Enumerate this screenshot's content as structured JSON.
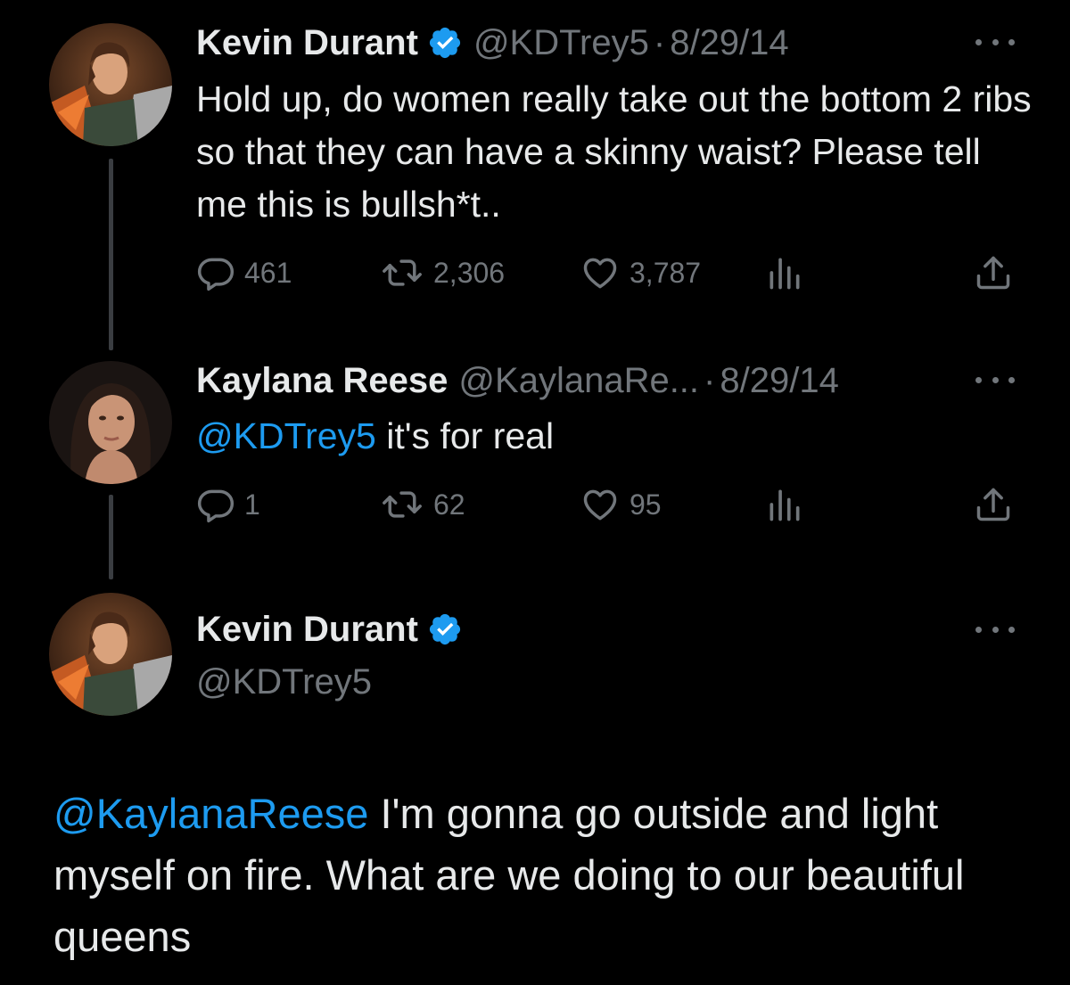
{
  "tweets": [
    {
      "author_name": "Kevin Durant",
      "handle": "@KDTrey5",
      "separator": "·",
      "date": "8/29/14",
      "verified": true,
      "avatar_icon": "animated-character-avatar",
      "text": "Hold up, do women really take out the bottom 2 ribs so that they can have a skinny waist? Please tell me this is bullsh*t..",
      "replies": "461",
      "retweets": "2,306",
      "likes": "3,787"
    },
    {
      "author_name": "Kaylana Reese",
      "handle": "@KaylanaRe...",
      "separator": "·",
      "date": "8/29/14",
      "verified": false,
      "avatar_icon": "woman-portrait-avatar",
      "mention": "@KDTrey5",
      "text": " it's for real",
      "replies": "1",
      "retweets": "62",
      "likes": "95"
    },
    {
      "author_name": "Kevin Durant",
      "handle": "@KDTrey5",
      "verified": true,
      "avatar_icon": "animated-character-avatar",
      "mention": "@KaylanaReese",
      "text": " I'm gonna go outside and light myself on fire. What are we doing to our beautiful queens"
    }
  ],
  "colors": {
    "background": "#000000",
    "text": "#e7e9ea",
    "secondary": "#71767b",
    "accent": "#1d9bf0",
    "thread_line": "#3a3d41"
  },
  "icons": [
    "reply-icon",
    "retweet-icon",
    "like-icon",
    "views-icon",
    "share-icon",
    "verified-badge-icon",
    "more-options-icon"
  ]
}
